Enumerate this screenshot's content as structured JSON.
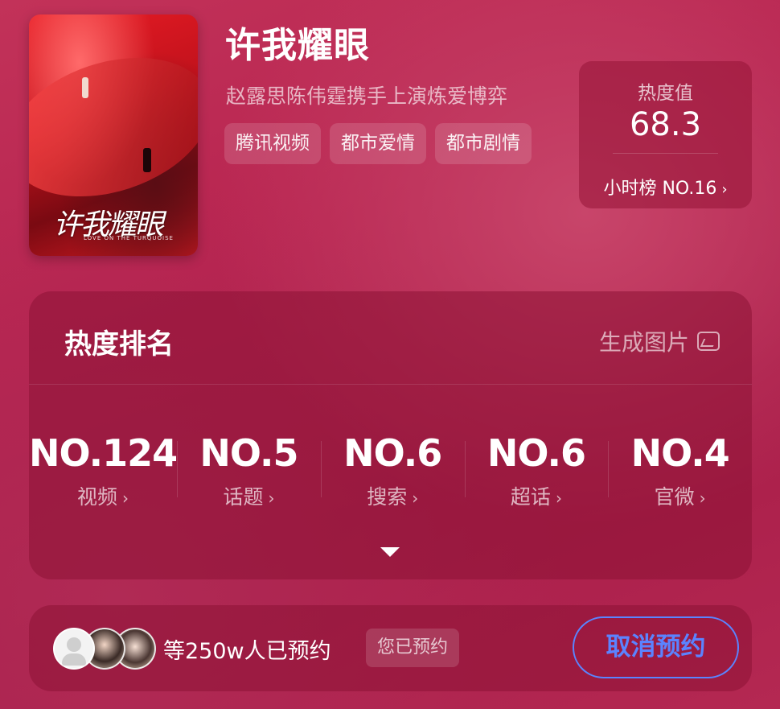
{
  "show": {
    "poster_logo_text": "许我耀眼",
    "poster_logo_sub": "LOVE ON THE TURQUOISE",
    "title": "许我耀眼",
    "subtitle": "赵露思陈伟霆携手上演炼爱博弈",
    "tags": [
      "腾讯视频",
      "都市爱情",
      "都市剧情"
    ]
  },
  "heat": {
    "label": "热度值",
    "value": "68.3",
    "rank": "小时榜 NO.16",
    "chevron": "›"
  },
  "ranking": {
    "title": "热度排名",
    "generate_label": "生成图片",
    "generate_icon": "image-export-icon",
    "items": [
      {
        "rank": "NO.124",
        "label": "视频"
      },
      {
        "rank": "NO.5",
        "label": "话题"
      },
      {
        "rank": "NO.6",
        "label": "搜索"
      },
      {
        "rank": "NO.6",
        "label": "超话"
      },
      {
        "rank": "NO.4",
        "label": "官微"
      }
    ],
    "chevron": "›",
    "expand_icon": "triangle-down-icon"
  },
  "reservation": {
    "count_text": "等250w人已预约",
    "status_badge": "您已预约",
    "cancel_label": "取消预约",
    "accent_color": "#5b83ff"
  }
}
